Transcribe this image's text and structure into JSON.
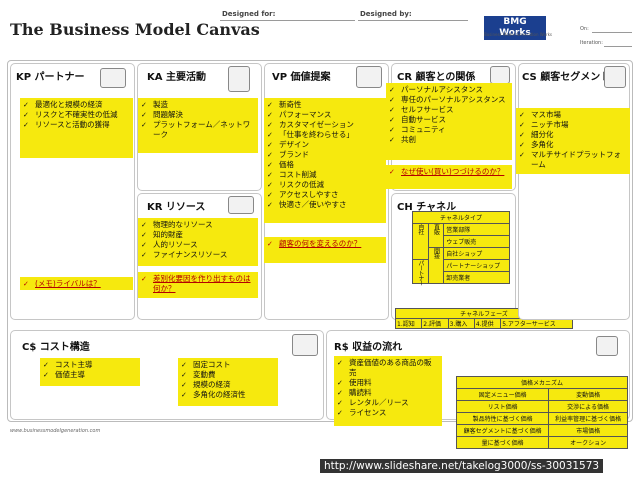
{
  "header": {
    "title": "The Business Model Canvas",
    "designed_for": "Designed for:",
    "designed_by": "Designed by:",
    "logo_text": "BMG Works",
    "logo_sub": "Business Model Generation Works",
    "on_label": "On:",
    "iteration_label": "Iteration:"
  },
  "blocks": {
    "kp": {
      "title": "KP パートナー",
      "items": [
        "最適化と規模の経済",
        "リスクと不確実性の低減",
        "リソースと活動の獲得"
      ],
      "note": "(メモ)ライバルは？"
    },
    "ka": {
      "title": "KA 主要活動",
      "items": [
        "製造",
        "問題解決",
        "プラットフォーム／ネットワーク"
      ],
      "note": "差別化要因を作り出すものは何か？"
    },
    "kr": {
      "title": "KR リソース",
      "items": [
        "物理的なリソース",
        "知的財産",
        "人的リソース",
        "ファイナンスリソース"
      ]
    },
    "vp": {
      "title": "VP 価値提案",
      "items": [
        "新奇性",
        "パフォーマンス",
        "カスタマイゼーション",
        "「仕事を終わらせる」",
        "デザイン",
        "ブランド",
        "価格",
        "コスト削減",
        "リスクの低減",
        "アクセスしやすさ",
        "快適さ／使いやすさ"
      ],
      "note": "顧客の何を変えるのか？"
    },
    "cr": {
      "title": "CR 顧客との関係",
      "items": [
        "パーソナルアシスタンス",
        "専任のパーソナルアシスタンス",
        "セルフサービス",
        "自動サービス",
        "コミュニティ",
        "共創"
      ],
      "note": "なぜ使い(買い)つづけるのか？"
    },
    "ch": {
      "title": "CH チャネル",
      "type_header": "チャネルタイプ",
      "own_label": "自社",
      "partner_label": "パートナー",
      "direct_label": "直販",
      "indirect_label": "間接",
      "rows": [
        "営業部隊",
        "ウェブ販売",
        "自社ショップ",
        "パートナーショップ",
        "卸売業者"
      ],
      "phase_header": "チャネルフェーズ",
      "phases": [
        "1.認知",
        "2.評価",
        "3.購入",
        "4.提供",
        "5.アフターサービス"
      ]
    },
    "cs": {
      "title": "CS 顧客セグメント",
      "items": [
        "マス市場",
        "ニッチ市場",
        "細分化",
        "多角化",
        "マルチサイドプラットフォーム"
      ]
    },
    "cost": {
      "title": "C$ コスト構造",
      "items_a": [
        "コスト主導",
        "価値主導"
      ],
      "items_b": [
        "固定コスト",
        "変動費",
        "規模の経済",
        "多角化の経済性"
      ]
    },
    "revenue": {
      "title": "R$ 収益の流れ",
      "items": [
        "資産価値のある商品の販売",
        "使用料",
        "購読料",
        "レンタル／リース",
        "ライセンス"
      ],
      "pricing": {
        "header": "価格メカニズム",
        "col_fixed": "固定メニュー価格",
        "col_dynamic": "変動価格",
        "rows": [
          [
            "リスト価格",
            "交渉による価格"
          ],
          [
            "製品特性に基づく価格",
            "利益率管理に基づく価格"
          ],
          [
            "顧客セグメントに基づく価格",
            "市場価格"
          ],
          [
            "量に基づく価格",
            "オークション"
          ]
        ]
      }
    }
  },
  "footer": {
    "source": "www.businessmodelgeneration.com",
    "url": "http://www.slideshare.net/takelog3000/ss-30031573"
  },
  "colors": {
    "sticky": "#f6e90e",
    "accent_red": "#b40000",
    "logo_blue": "#1b3f8f"
  }
}
